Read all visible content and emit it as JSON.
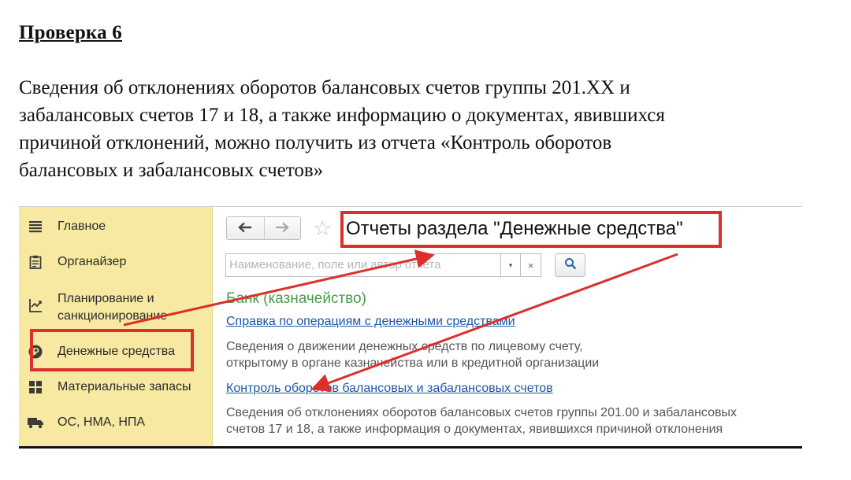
{
  "document": {
    "title": "Проверка 6",
    "paragraph_lines": [
      "Сведения об отклонениях оборотов балансовых счетов группы 201.ХХ и",
      "забалансовых счетов 17 и 18, а также информацию о документах, явившихся",
      "причиной отклонений, можно получить из отчета «Контроль оборотов",
      "балансовых и забалансовых счетов»"
    ]
  },
  "sidebar": {
    "items": [
      {
        "label_lines": [
          "Главное"
        ],
        "icon": "menu-icon"
      },
      {
        "label_lines": [
          "Органайзер"
        ],
        "icon": "clipboard-icon"
      },
      {
        "label_lines": [
          "Планирование и",
          "санкционирование"
        ],
        "icon": "planning-icon"
      },
      {
        "label_lines": [
          "Денежные средства"
        ],
        "icon": "coin-icon"
      },
      {
        "label_lines": [
          "Материальные запасы"
        ],
        "icon": "grid-icon"
      },
      {
        "label_lines": [
          "ОС, НМА, НПА"
        ],
        "icon": "truck-icon"
      }
    ]
  },
  "header": {
    "back_icon": "back-arrow-icon",
    "forward_icon": "forward-arrow-icon",
    "favorite_icon": "star-icon",
    "page_title": "Отчеты раздела \"Денежные средства\""
  },
  "search": {
    "placeholder": "Наименование, поле или автор отчета",
    "dropdown_glyph": "▾",
    "clear_glyph": "×",
    "button_icon": "magnifier-icon"
  },
  "section": {
    "title": "Банк (казначейство)",
    "reports": [
      {
        "link": "Справка по операциям с денежными средствами",
        "description_lines": [
          "Сведения о движении денежных средств по лицевому счету,",
          "открытому в органе казначейства или в кредитной организации"
        ]
      },
      {
        "link": "Контроль оборотов балансовых и забалансовых счетов",
        "description_lines": [
          "Сведения об отклонениях оборотов балансовых счетов группы 201.00 и забалансовых",
          "счетов 17 и 18, а также информация о документах, явившихся причиной отклонения"
        ]
      }
    ]
  },
  "colors": {
    "sidebar_bg": "#f7e9a1",
    "highlight": "#dc2f2b",
    "section_title": "#4a9a49",
    "link": "#1d55a8"
  }
}
